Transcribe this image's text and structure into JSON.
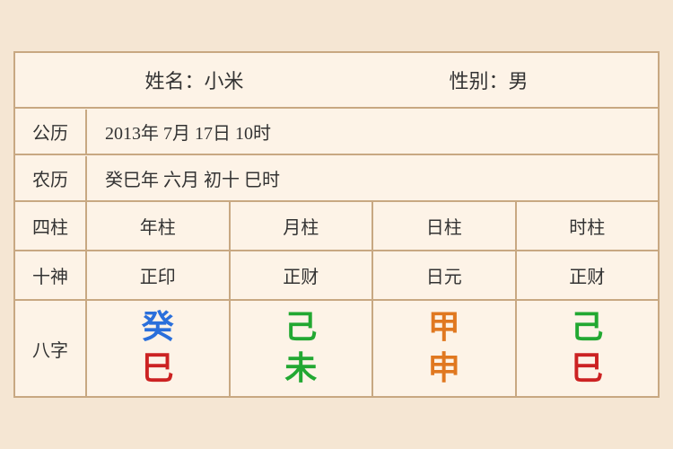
{
  "header": {
    "name_label": "姓名：小米",
    "gender_label": "性别：男"
  },
  "gregorian": {
    "label": "公历",
    "value": "2013年 7月 17日 10时"
  },
  "lunar": {
    "label": "农历",
    "value": "癸巳年 六月 初十 巳时"
  },
  "columns": {
    "label": "四柱",
    "year": "年柱",
    "month": "月柱",
    "day": "日柱",
    "hour": "时柱"
  },
  "shishen": {
    "label": "十神",
    "year": "正印",
    "month": "正财",
    "day": "日元",
    "hour": "正财"
  },
  "bazhi": {
    "label": "八字",
    "year_top": "癸",
    "year_bottom": "巳",
    "month_top": "己",
    "month_bottom": "未",
    "day_top": "甲",
    "day_bottom": "申",
    "hour_top": "己",
    "hour_bottom": "巳"
  }
}
